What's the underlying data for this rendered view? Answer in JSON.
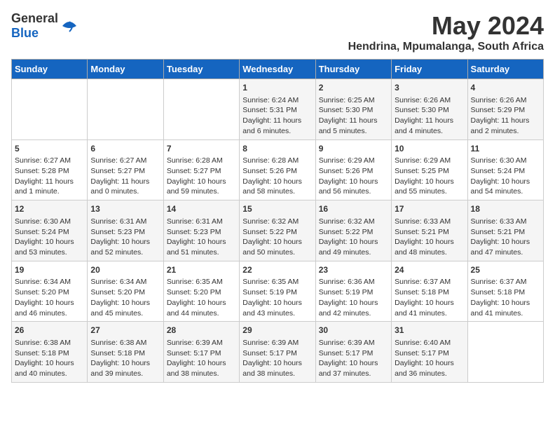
{
  "logo": {
    "general": "General",
    "blue": "Blue"
  },
  "title": "May 2024",
  "subtitle": "Hendrina, Mpumalanga, South Africa",
  "days_header": [
    "Sunday",
    "Monday",
    "Tuesday",
    "Wednesday",
    "Thursday",
    "Friday",
    "Saturday"
  ],
  "weeks": [
    [
      {
        "day": "",
        "content": ""
      },
      {
        "day": "",
        "content": ""
      },
      {
        "day": "",
        "content": ""
      },
      {
        "day": "1",
        "content": "Sunrise: 6:24 AM\nSunset: 5:31 PM\nDaylight: 11 hours and 6 minutes."
      },
      {
        "day": "2",
        "content": "Sunrise: 6:25 AM\nSunset: 5:30 PM\nDaylight: 11 hours and 5 minutes."
      },
      {
        "day": "3",
        "content": "Sunrise: 6:26 AM\nSunset: 5:30 PM\nDaylight: 11 hours and 4 minutes."
      },
      {
        "day": "4",
        "content": "Sunrise: 6:26 AM\nSunset: 5:29 PM\nDaylight: 11 hours and 2 minutes."
      }
    ],
    [
      {
        "day": "5",
        "content": "Sunrise: 6:27 AM\nSunset: 5:28 PM\nDaylight: 11 hours and 1 minute."
      },
      {
        "day": "6",
        "content": "Sunrise: 6:27 AM\nSunset: 5:27 PM\nDaylight: 11 hours and 0 minutes."
      },
      {
        "day": "7",
        "content": "Sunrise: 6:28 AM\nSunset: 5:27 PM\nDaylight: 10 hours and 59 minutes."
      },
      {
        "day": "8",
        "content": "Sunrise: 6:28 AM\nSunset: 5:26 PM\nDaylight: 10 hours and 58 minutes."
      },
      {
        "day": "9",
        "content": "Sunrise: 6:29 AM\nSunset: 5:26 PM\nDaylight: 10 hours and 56 minutes."
      },
      {
        "day": "10",
        "content": "Sunrise: 6:29 AM\nSunset: 5:25 PM\nDaylight: 10 hours and 55 minutes."
      },
      {
        "day": "11",
        "content": "Sunrise: 6:30 AM\nSunset: 5:24 PM\nDaylight: 10 hours and 54 minutes."
      }
    ],
    [
      {
        "day": "12",
        "content": "Sunrise: 6:30 AM\nSunset: 5:24 PM\nDaylight: 10 hours and 53 minutes."
      },
      {
        "day": "13",
        "content": "Sunrise: 6:31 AM\nSunset: 5:23 PM\nDaylight: 10 hours and 52 minutes."
      },
      {
        "day": "14",
        "content": "Sunrise: 6:31 AM\nSunset: 5:23 PM\nDaylight: 10 hours and 51 minutes."
      },
      {
        "day": "15",
        "content": "Sunrise: 6:32 AM\nSunset: 5:22 PM\nDaylight: 10 hours and 50 minutes."
      },
      {
        "day": "16",
        "content": "Sunrise: 6:32 AM\nSunset: 5:22 PM\nDaylight: 10 hours and 49 minutes."
      },
      {
        "day": "17",
        "content": "Sunrise: 6:33 AM\nSunset: 5:21 PM\nDaylight: 10 hours and 48 minutes."
      },
      {
        "day": "18",
        "content": "Sunrise: 6:33 AM\nSunset: 5:21 PM\nDaylight: 10 hours and 47 minutes."
      }
    ],
    [
      {
        "day": "19",
        "content": "Sunrise: 6:34 AM\nSunset: 5:20 PM\nDaylight: 10 hours and 46 minutes."
      },
      {
        "day": "20",
        "content": "Sunrise: 6:34 AM\nSunset: 5:20 PM\nDaylight: 10 hours and 45 minutes."
      },
      {
        "day": "21",
        "content": "Sunrise: 6:35 AM\nSunset: 5:20 PM\nDaylight: 10 hours and 44 minutes."
      },
      {
        "day": "22",
        "content": "Sunrise: 6:35 AM\nSunset: 5:19 PM\nDaylight: 10 hours and 43 minutes."
      },
      {
        "day": "23",
        "content": "Sunrise: 6:36 AM\nSunset: 5:19 PM\nDaylight: 10 hours and 42 minutes."
      },
      {
        "day": "24",
        "content": "Sunrise: 6:37 AM\nSunset: 5:18 PM\nDaylight: 10 hours and 41 minutes."
      },
      {
        "day": "25",
        "content": "Sunrise: 6:37 AM\nSunset: 5:18 PM\nDaylight: 10 hours and 41 minutes."
      }
    ],
    [
      {
        "day": "26",
        "content": "Sunrise: 6:38 AM\nSunset: 5:18 PM\nDaylight: 10 hours and 40 minutes."
      },
      {
        "day": "27",
        "content": "Sunrise: 6:38 AM\nSunset: 5:18 PM\nDaylight: 10 hours and 39 minutes."
      },
      {
        "day": "28",
        "content": "Sunrise: 6:39 AM\nSunset: 5:17 PM\nDaylight: 10 hours and 38 minutes."
      },
      {
        "day": "29",
        "content": "Sunrise: 6:39 AM\nSunset: 5:17 PM\nDaylight: 10 hours and 38 minutes."
      },
      {
        "day": "30",
        "content": "Sunrise: 6:39 AM\nSunset: 5:17 PM\nDaylight: 10 hours and 37 minutes."
      },
      {
        "day": "31",
        "content": "Sunrise: 6:40 AM\nSunset: 5:17 PM\nDaylight: 10 hours and 36 minutes."
      },
      {
        "day": "",
        "content": ""
      }
    ]
  ]
}
